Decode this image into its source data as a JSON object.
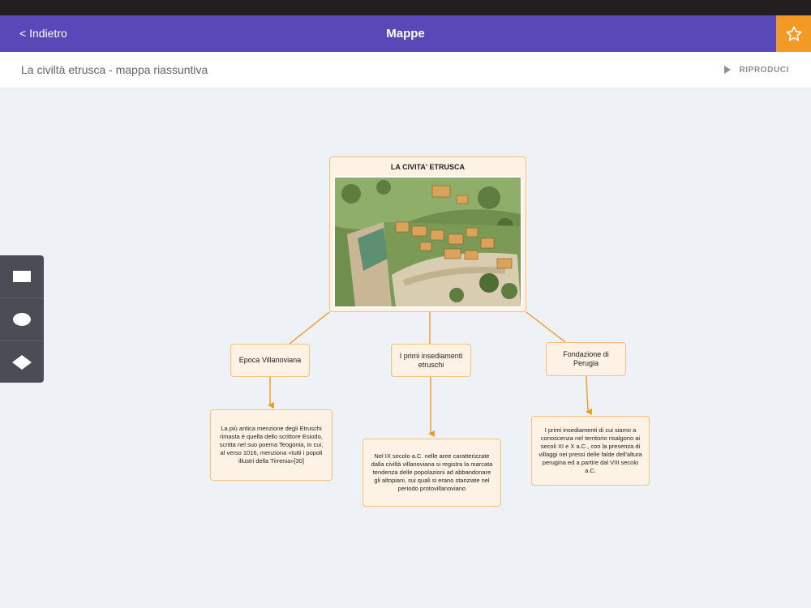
{
  "nav": {
    "back_label": "< Indietro",
    "title": "Mappe",
    "favorite_icon": "star-icon"
  },
  "subheader": {
    "title": "La civiltà etrusca - mappa riassuntiva",
    "play_label": "RIPRODUCI",
    "play_icon": "play-icon"
  },
  "tools": [
    {
      "name": "rectangle-shape-icon"
    },
    {
      "name": "ellipse-shape-icon"
    },
    {
      "name": "diamond-shape-icon"
    }
  ],
  "map": {
    "main": {
      "title": "LA CIVITA' ETRUSCA",
      "image": "etruscan-town-illustration"
    },
    "branches": [
      {
        "label": "Epoca Villanoviana",
        "text": "La più antica menzione degli Etruschi rimasta è quella dello scrittore Esiodo, scritta nel suo poema Teogonia, in cui, al verso 1016, menziona «tutti i popoli illustri della Tirrenia»[30]"
      },
      {
        "label": "I primi insediamenti etruschi",
        "text": "Nel IX secolo a.C. nelle aree caratterizzate dalla civiltà villanoviana si registra la marcata tendenza delle popolazioni ad abbandonare gli altopiani, sui quali si erano stanziate nel periodo protovillanoviano"
      },
      {
        "label": "Fondazione di Perugia",
        "text": "I primi insediamenti di cui siamo a conoscenza nel territorio risalgono ai secoli XI e X a.C., con la presenza di villaggi nei pressi delle falde dell'altura perugina ed a partire dal VIII secolo a.C."
      }
    ]
  },
  "colors": {
    "nav": "#5a48b8",
    "accent": "#f39a26",
    "node_fill": "#fdf2e4",
    "node_border": "#f5c07c",
    "connector": "#f39a26"
  }
}
